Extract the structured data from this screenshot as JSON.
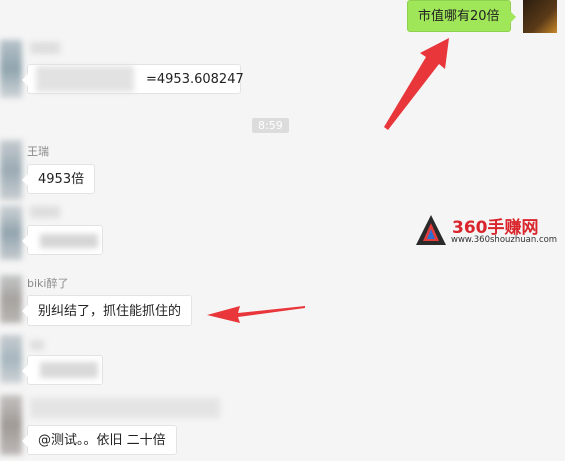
{
  "messages": {
    "m1": "市值哪有20倍",
    "m2": "=4953.608247",
    "m3": "4953倍",
    "m4": "别纠结了，抓住能抓住的",
    "m5": "@测试。。依旧 二十倍"
  },
  "names": {
    "n1": "王瑞",
    "n2": "biki醉了"
  },
  "time": "8:59",
  "watermark": {
    "title": "360手赚网",
    "url": "www.360shouzhuan.com"
  },
  "colors": {
    "green_bubble": "#9fe658",
    "arrow": "#e8363a"
  }
}
